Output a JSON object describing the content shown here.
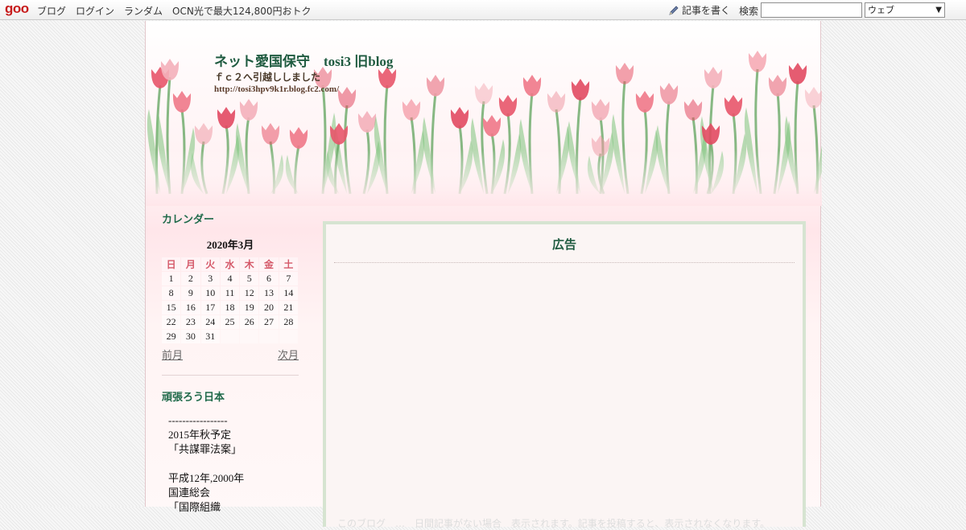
{
  "topbar": {
    "logo": "goo",
    "nav": [
      "ブログ",
      "ログイン",
      "ランダム",
      "OCN光で最大124,800円おトク"
    ],
    "write_label": "記事を書く",
    "search_label": "検索",
    "search_value": "",
    "search_scope": "ウェブ"
  },
  "header": {
    "title": "ネット愛国保守　tosi3 旧blog",
    "description": "ｆｃ２へ引越ししました",
    "url": "http://tosi3hpv9k1r.blog.fc2.com/"
  },
  "sidebar": {
    "calendar": {
      "heading": "カレンダー",
      "month_label": "2020年3月",
      "weekdays": [
        "日",
        "月",
        "火",
        "水",
        "木",
        "金",
        "土"
      ],
      "weeks": [
        [
          "1",
          "2",
          "3",
          "4",
          "5",
          "6",
          "7"
        ],
        [
          "8",
          "9",
          "10",
          "11",
          "12",
          "13",
          "14"
        ],
        [
          "15",
          "16",
          "17",
          "18",
          "19",
          "20",
          "21"
        ],
        [
          "22",
          "23",
          "24",
          "25",
          "26",
          "27",
          "28"
        ],
        [
          "29",
          "30",
          "31",
          "",
          "",
          "",
          ""
        ]
      ],
      "prev_label": "前月",
      "next_label": "次月"
    },
    "section2": {
      "heading": "頑張ろう日本",
      "lines": [
        "-----------------",
        "2015年秋予定",
        "「共謀罪法案」",
        "",
        "平成12年,2000年",
        "国連総会",
        "「国際組織"
      ]
    }
  },
  "main": {
    "ad_title": "広告",
    "faded_text": "このブログ　…　日間記事がない場合　表示されます。記事を投稿すると、表示されなくなります。"
  },
  "colors": {
    "accent_green": "#1f5b40",
    "calendar_weekday": "#d55a6a",
    "logo_red": "#c71c1c",
    "ad_border": "#d6e4d1"
  }
}
